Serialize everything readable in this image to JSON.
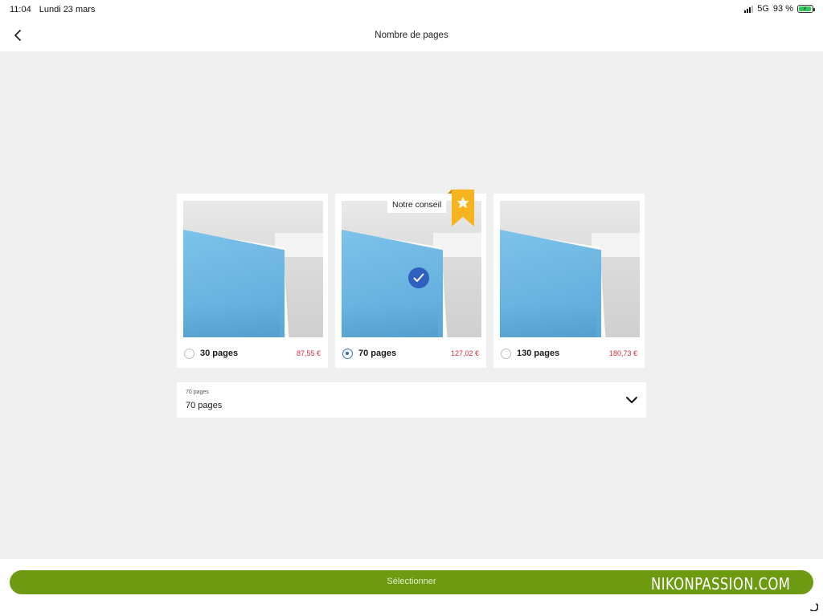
{
  "status_bar": {
    "time": "11:04",
    "date": "Lundi 23 mars",
    "network": "5G",
    "battery": "93 %"
  },
  "nav": {
    "title": "Nombre de pages",
    "back_icon": "chevron-left-icon"
  },
  "recommendation": {
    "label": "Notre conseil",
    "icon": "star-ribbon-icon",
    "color": "#f6b41f"
  },
  "options": [
    {
      "label": "30 pages",
      "price": "87,55 €",
      "selected": false
    },
    {
      "label": "70 pages",
      "price": "127,02 €",
      "selected": true
    },
    {
      "label": "130 pages",
      "price": "180,73 €",
      "selected": false
    }
  ],
  "dropdown": {
    "caption": "70 pages",
    "value": "70 pages",
    "icon": "chevron-down-icon"
  },
  "footer": {
    "button_label": "Sélectionner",
    "watermark": "NIKONPASSION.COM"
  },
  "colors": {
    "accent_blue": "#2f5fbf",
    "price_red": "#d42d3c",
    "button_green": "#6c9a10",
    "background": "#efefef"
  }
}
